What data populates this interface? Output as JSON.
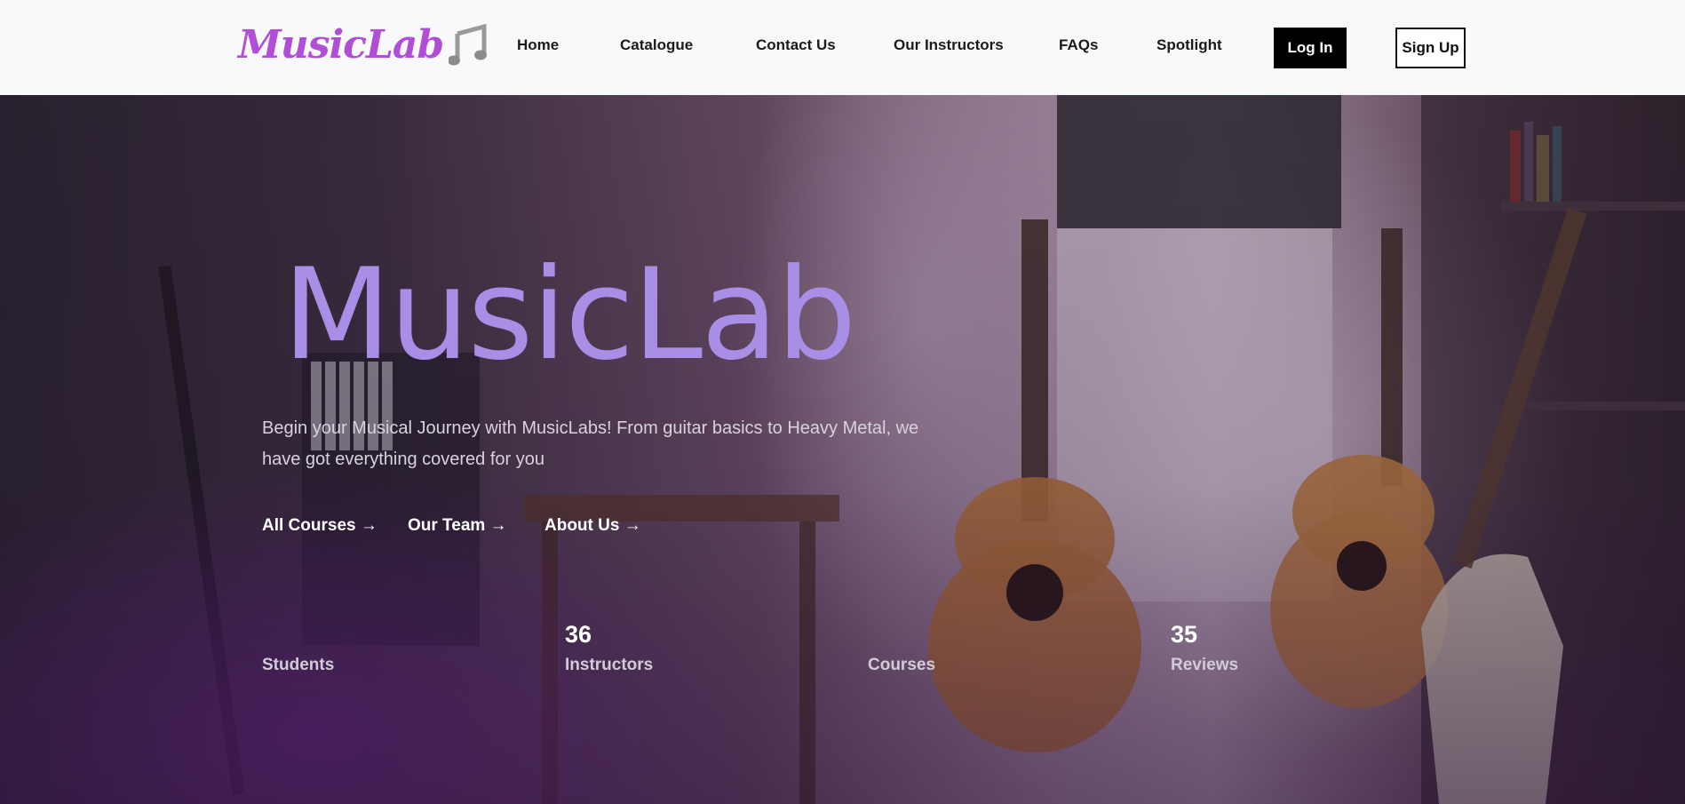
{
  "brand": {
    "logo_text": "MusicLab",
    "logo_icon": "music-note-icon",
    "accent_color": "#b04fd6"
  },
  "nav": {
    "items": [
      {
        "label": "Home"
      },
      {
        "label": "Catalogue"
      },
      {
        "label": "Contact Us"
      },
      {
        "label": "Our Instructors"
      },
      {
        "label": "FAQs"
      },
      {
        "label": "Spotlight"
      }
    ],
    "login_label": "Log In",
    "signup_label": "Sign Up"
  },
  "hero": {
    "title": "MusicLab",
    "title_color": "#a98ee6",
    "description": "Begin your Musical Journey with MusicLabs! From guitar basics to Heavy Metal, we have got everything covered for you",
    "links": [
      {
        "label": "All Courses →"
      },
      {
        "label": "Our Team →"
      },
      {
        "label": "About Us →"
      }
    ]
  },
  "stats": [
    {
      "value": "",
      "label": "Students"
    },
    {
      "value": "36",
      "label": "Instructors"
    },
    {
      "value": "",
      "label": "Courses"
    },
    {
      "value": "35",
      "label": "Reviews"
    }
  ]
}
